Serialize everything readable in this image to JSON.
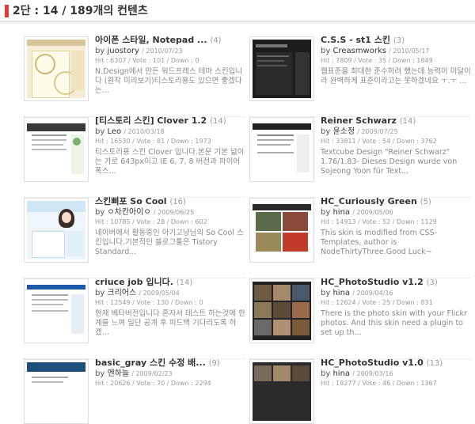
{
  "header": {
    "title": "2단 : 14 / 189개의 컨텐츠"
  },
  "items": [
    {
      "title": "아이폰 스타일, Notepad ...",
      "count": "(4)",
      "by": "by ",
      "author": "juostory",
      "date": "/ 2010/07/23",
      "stats": "Hit : 6307 / Vote : 101 / Down : 0",
      "desc": "N.Design에서 만든 워드프레스 테마 스킨입니다 (원작 미리보기)티스토리용도 있으면 좋겠다는..."
    },
    {
      "title": "C.S.S - st1 스킨",
      "count": "(3)",
      "by": "by ",
      "author": "Creasmworks",
      "date": "/ 2010/05/17",
      "stats": "Hit : 7809 / Vote : 35 / Down : 1849",
      "desc": "웹표준을 최대한 준수하려 했는데 능력이 미달이라 완벽하게 표준이라고는 못하겠네요 ㅜ.ㅜ ..."
    },
    {
      "title": "[티스토리 스킨] Clover 1.2",
      "count": "(14)",
      "by": "by ",
      "author": "Leo",
      "date": "/ 2010/03/18",
      "stats": "Hit : 16530 / Vote : 81 / Down : 1973",
      "desc": "티스토리용 스킨 Clover 입니다.본문 기본 넓이는 가로 643px이고 IE 6, 7, 8 버전과 파이어폭스..."
    },
    {
      "title": "Reiner Schwarz",
      "count": "(14)",
      "by": "by ",
      "author": "윤소정",
      "date": "/ 2009/07/25",
      "stats": "Hit : 33811 / Vote : 54 / Down : 3762",
      "desc": "Textcube Design \"Reiner Schwarz\" 1.76/1.83- Dieses Design wurde von Sojeong Yoon für Text..."
    },
    {
      "title": "스킨삐포 So Cool",
      "count": "(16)",
      "by": "by ",
      "author": "ㅇ차칸아이ㅇ",
      "date": "/ 2009/06/25",
      "stats": "Hit : 10785 / Vote : 28 / Down : 602",
      "desc": "네이버에서 활동중인 아기고냥님의 So Cool 스킨입니다.기본적인 블로그툴은 Tistory Standard..."
    },
    {
      "title": "HC_Curiously Green",
      "count": "(5)",
      "by": "by ",
      "author": "hina",
      "date": "/ 2009/05/06",
      "stats": "Hit : 14913 / Vote : 52 / Down : 1129",
      "desc": "This skin is modified from CSS-Templates, author is NodeThirtyThree.Good Luck~"
    },
    {
      "title": "criuce job 입니다.",
      "count": "(14)",
      "by": "by ",
      "author": "크리어스",
      "date": "/ 2009/05/04",
      "stats": "Hit : 12549 / Vote : 130 / Down : 0",
      "desc": "현재 베타버전입니다 혼자서 테스트 하는것에 한계를 느껴 일단 공개 후 피드백 기다리도록 하겠..."
    },
    {
      "title": "HC_PhotoStudio v1.2",
      "count": "(3)",
      "by": "by ",
      "author": "hina",
      "date": "/ 2009/04/16",
      "stats": "Hit : 12624 / Vote : 25 / Down : 831",
      "desc": "There is the photo skin with your Flickr photos. And this skin need a plugin to set up th..."
    },
    {
      "title": "basic_gray 스킨 수정 배...",
      "count": "(9)",
      "by": "by ",
      "author": "엔하늘",
      "date": "/ 2009/02/23",
      "stats": "Hit : 20626 / Vote : 70 / Down : 2294",
      "desc": ""
    },
    {
      "title": "HC_PhotoStudio v1.0",
      "count": "(13)",
      "by": "by ",
      "author": "hina",
      "date": "/ 2009/03/16",
      "stats": "Hit : 18277 / Vote : 46 / Down : 1367",
      "desc": ""
    }
  ]
}
